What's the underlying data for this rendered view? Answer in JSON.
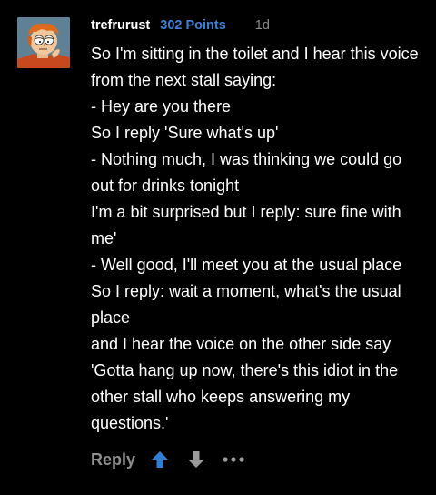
{
  "comment": {
    "username": "trefrurust",
    "points": "302 Points",
    "age": "1d",
    "avatar_icon": "fry-avatar-icon",
    "lines": [
      "So I'm sitting in the toilet and I hear this voice from the next stall saying:",
      "- Hey are you there",
      "So I reply 'Sure what's up'",
      "- Nothing much, I was thinking we could go out for drinks tonight",
      "I'm a bit surprised but I reply: sure fine with me'",
      "- Well good, I'll meet you at the usual place",
      "So I reply: wait a moment, what's the usual place",
      "and I hear the voice on the other side say 'Gotta hang up now, there's this idiot in the other stall who keeps answering my questions.'"
    ]
  },
  "actions": {
    "reply_label": "Reply",
    "upvote_icon": "arrow-up-icon",
    "downvote_icon": "arrow-down-icon",
    "more_icon": "more-dots-icon"
  },
  "colors": {
    "background": "#000000",
    "text": "#ffffff",
    "points": "#3a82d8",
    "muted": "#8b8b8b",
    "upvote": "#2f7fd6",
    "downvote": "#9a9a9a"
  }
}
